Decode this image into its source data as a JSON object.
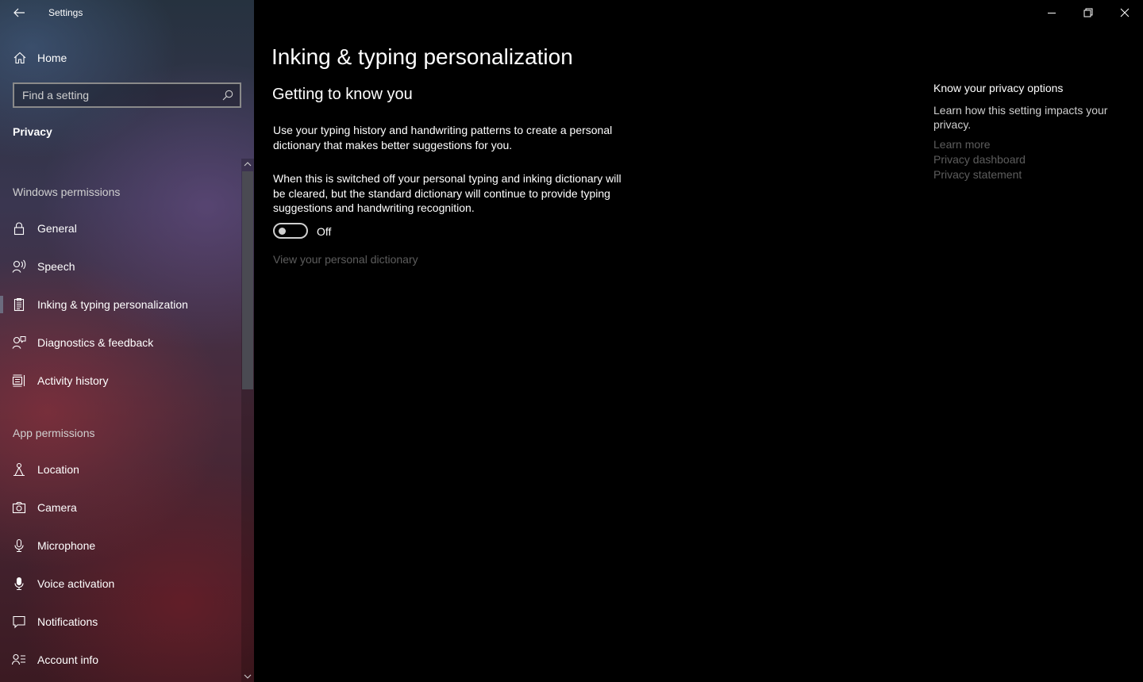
{
  "app": {
    "title": "Settings"
  },
  "sidebar": {
    "home_label": "Home",
    "search_placeholder": "Find a setting",
    "search_value": "",
    "current_section": "Privacy",
    "groups": [
      {
        "heading": "Windows permissions",
        "items": [
          {
            "label": "General",
            "icon": "lock-icon"
          },
          {
            "label": "Speech",
            "icon": "speech-icon"
          },
          {
            "label": "Inking & typing personalization",
            "icon": "clipboard-icon",
            "active": true
          },
          {
            "label": "Diagnostics & feedback",
            "icon": "feedback-icon"
          },
          {
            "label": "Activity history",
            "icon": "timeline-icon"
          }
        ]
      },
      {
        "heading": "App permissions",
        "items": [
          {
            "label": "Location",
            "icon": "location-icon"
          },
          {
            "label": "Camera",
            "icon": "camera-icon"
          },
          {
            "label": "Microphone",
            "icon": "microphone-icon"
          },
          {
            "label": "Voice activation",
            "icon": "voice-activation-icon"
          },
          {
            "label": "Notifications",
            "icon": "notification-icon"
          },
          {
            "label": "Account info",
            "icon": "account-info-icon"
          }
        ]
      }
    ]
  },
  "main": {
    "page_title": "Inking & typing personalization",
    "section_title": "Getting to know you",
    "paragraph1": "Use your typing history and handwriting patterns to create a personal dictionary that makes better suggestions for you.",
    "paragraph2": "When this is switched off your personal typing and inking dictionary will be cleared, but the standard dictionary will continue to provide typing suggestions and handwriting recognition.",
    "toggle_state": "Off",
    "toggle_on": false,
    "dictionary_link": "View your personal dictionary"
  },
  "privacy_panel": {
    "title": "Know your privacy options",
    "description": "Learn how this setting impacts your privacy.",
    "links": [
      "Learn more",
      "Privacy dashboard",
      "Privacy statement"
    ]
  },
  "colors": {
    "background": "#000000",
    "disabled_link": "#5d5d5d",
    "text": "#ffffff"
  }
}
